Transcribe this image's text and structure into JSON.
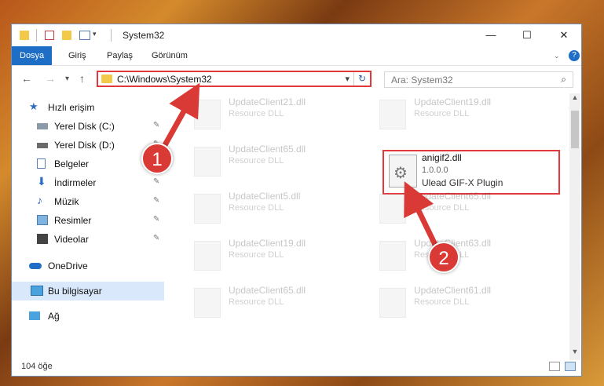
{
  "window": {
    "title": "System32",
    "controls": {
      "minimize": "—",
      "maximize": "☐",
      "close": "✕"
    }
  },
  "ribbon": {
    "tabs": [
      "Dosya",
      "Giriş",
      "Paylaş",
      "Görünüm"
    ],
    "help": "?"
  },
  "navigation": {
    "back": "←",
    "forward": "→",
    "recent": "▾",
    "up": "↑"
  },
  "address": {
    "path": "C:\\Windows\\System32",
    "dropdown": "▾",
    "refresh": "↻"
  },
  "search": {
    "placeholder": "Ara: System32",
    "icon": "search-icon"
  },
  "sidebar": {
    "items": [
      {
        "label": "Hızlı erişim",
        "icon": "star-icon",
        "pinned": false
      },
      {
        "label": "Yerel Disk (C:)",
        "icon": "drive-icon",
        "pinned": true
      },
      {
        "label": "Yerel Disk (D:)",
        "icon": "drive-icon",
        "pinned": true
      },
      {
        "label": "Belgeler",
        "icon": "documents-icon",
        "pinned": true
      },
      {
        "label": "İndirmeler",
        "icon": "download-icon",
        "pinned": true
      },
      {
        "label": "Müzik",
        "icon": "music-icon",
        "pinned": true
      },
      {
        "label": "Resimler",
        "icon": "pictures-icon",
        "pinned": true
      },
      {
        "label": "Videolar",
        "icon": "videos-icon",
        "pinned": true
      },
      {
        "label": "OneDrive",
        "icon": "cloud-icon",
        "pinned": false
      },
      {
        "label": "Bu bilgisayar",
        "icon": "computer-icon",
        "pinned": false,
        "selected": true
      },
      {
        "label": "Ağ",
        "icon": "network-icon",
        "pinned": false
      }
    ],
    "pin_glyph": "📌"
  },
  "files": [
    {
      "name": "UpdateClient21.dll",
      "type": "Resource DLL"
    },
    {
      "name": "UpdateClient19.dll",
      "type": "Resource DLL"
    },
    {
      "name": "UpdateClient65.dll",
      "type": "Resource DLL"
    },
    {
      "name": "anigif2.dll",
      "version": "1.0.0.0",
      "description": "Ulead GIF-X Plugin",
      "highlighted": true
    },
    {
      "name": "UpdateClient5.dll",
      "type": "Resource DLL"
    },
    {
      "name": "UpdateClient65.dll",
      "type": "Resource DLL"
    },
    {
      "name": "UpdateClient19.dll",
      "type": "Resource DLL"
    },
    {
      "name": "UpdateClient63.dll",
      "type": "Resource DLL"
    },
    {
      "name": "UpdateClient65.dll",
      "type": "Resource DLL"
    },
    {
      "name": "UpdateClient61.dll",
      "type": "Resource DLL"
    }
  ],
  "status": {
    "item_count": "104 öğe"
  },
  "annotations": {
    "marker1": "1",
    "marker2": "2",
    "color": "#d93a36"
  }
}
